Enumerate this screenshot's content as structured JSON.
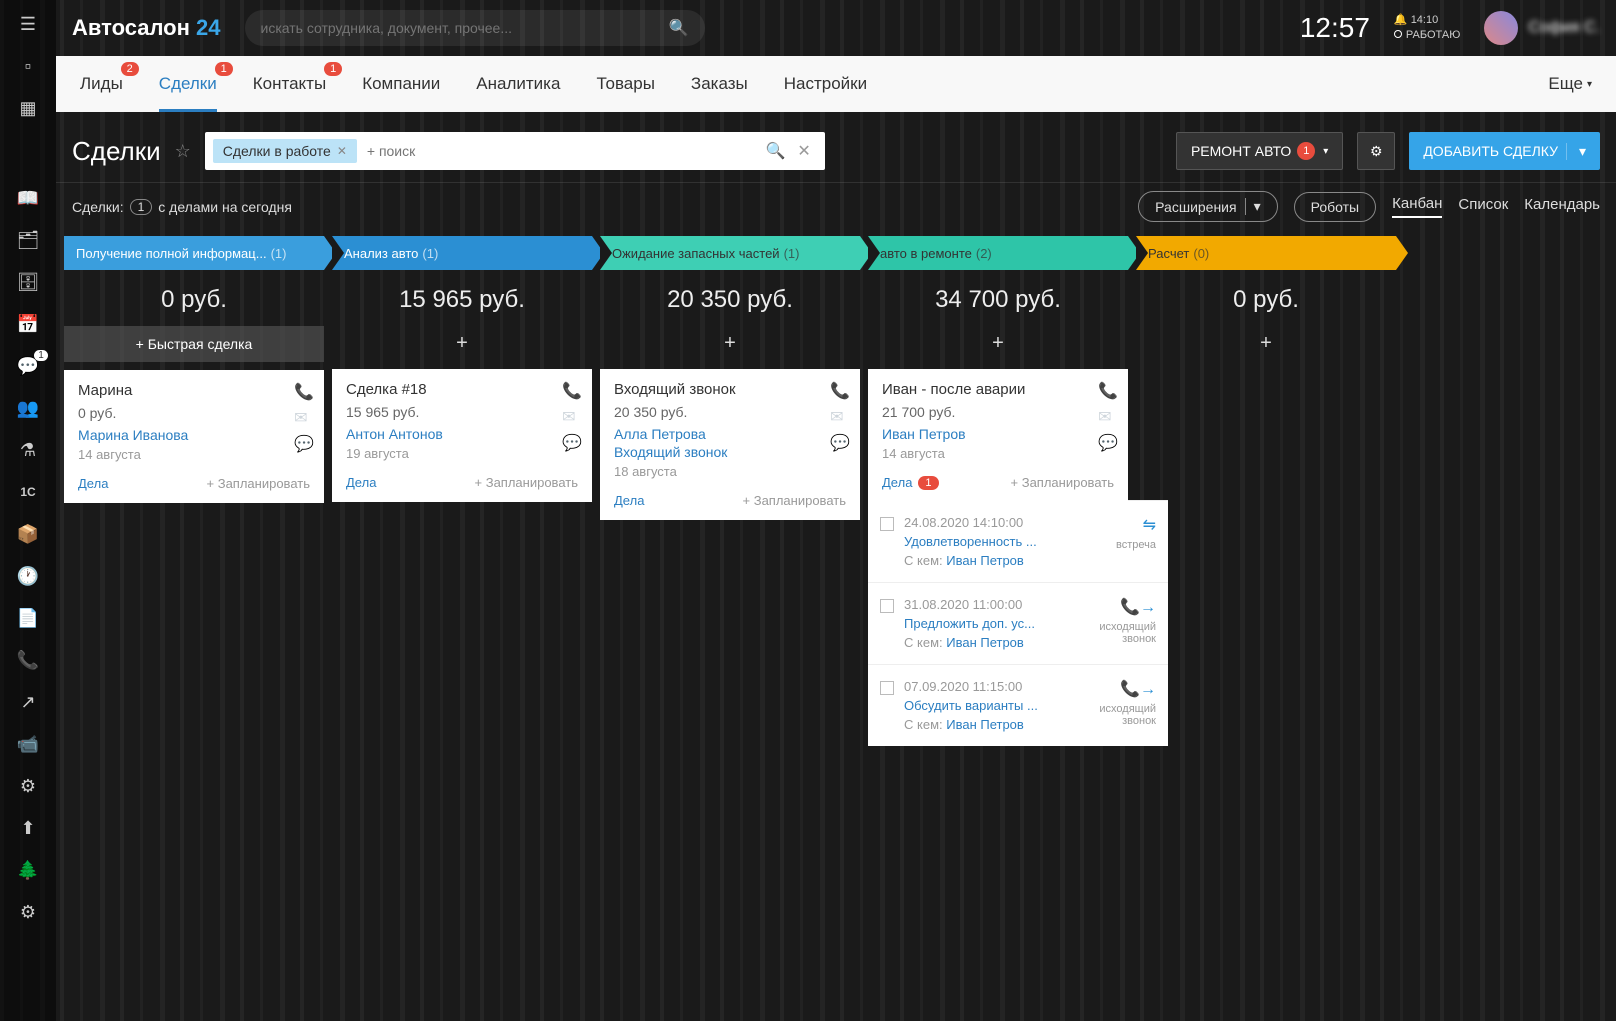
{
  "header": {
    "logo1": "Автосалон ",
    "logo2": "24",
    "search_placeholder": "искать сотрудника, документ, прочее...",
    "clock": "12:57",
    "notif_time": "14:10",
    "status": "РАБОТАЮ",
    "username": "София С."
  },
  "nav": {
    "items": [
      {
        "label": "Лиды",
        "badge": "2"
      },
      {
        "label": "Сделки",
        "badge": "1",
        "active": true
      },
      {
        "label": "Контакты",
        "badge": "1"
      },
      {
        "label": "Компании"
      },
      {
        "label": "Аналитика"
      },
      {
        "label": "Товары"
      },
      {
        "label": "Заказы"
      },
      {
        "label": "Настройки"
      }
    ],
    "more": "Еще"
  },
  "page": {
    "title": "Сделки",
    "filter_chip": "Сделки в работе",
    "filter_placeholder": "+ поиск",
    "funnel_btn": "РЕМОНТ АВТО",
    "funnel_badge": "1",
    "add_btn": "ДОБАВИТЬ СДЕЛКУ"
  },
  "subhead": {
    "label": "Сделки:",
    "count": "1",
    "suffix": "с делами на сегодня",
    "ext": "Расширения",
    "robots": "Роботы",
    "views": [
      "Канбан",
      "Список",
      "Календарь"
    ],
    "active_view": 0
  },
  "columns": [
    {
      "title": "Получение полной информац...",
      "count": "(1)",
      "sum": "0 руб.",
      "color": "h-blue1",
      "quick": true,
      "quick_label": "+  Быстрая сделка"
    },
    {
      "title": "Анализ авто",
      "count": "(1)",
      "sum": "15 965 руб.",
      "color": "h-blue2"
    },
    {
      "title": "Ожидание запасных частей",
      "count": "(1)",
      "sum": "20 350 руб.",
      "color": "h-teal1"
    },
    {
      "title": "авто в ремонте",
      "count": "(2)",
      "sum": "34 700 руб.",
      "color": "h-teal2"
    },
    {
      "title": "Расчет",
      "count": "(0)",
      "sum": "0 руб.",
      "color": "h-orange"
    }
  ],
  "cards": {
    "c0": {
      "title": "Марина",
      "money": "0 руб.",
      "contact": "Марина Иванова",
      "date": "14 августа",
      "dela": "Дела",
      "plan": "+ Запланировать",
      "phone_active": true
    },
    "c1": {
      "title": "Сделка #18",
      "money": "15 965 руб.",
      "contact": "Антон Антонов",
      "date": "19 августа",
      "dela": "Дела",
      "plan": "+ Запланировать"
    },
    "c2": {
      "title": "Входящий звонок",
      "money": "20 350 руб.",
      "contact": "Алла Петрова",
      "contact2": "Входящий звонок",
      "date": "18 августа",
      "dela": "Дела",
      "plan": "+ Запланировать"
    },
    "c3": {
      "title": "Иван - после аварии",
      "money": "21 700 руб.",
      "contact": "Иван Петров",
      "date": "14 августа",
      "dela": "Дела",
      "dela_badge": "1",
      "plan": "+ Запланировать",
      "phone_active": true
    }
  },
  "tasks": [
    {
      "time": "24.08.2020 14:10:00",
      "title": "Удовлетворенность ...",
      "who_prefix": "С кем: ",
      "who": "Иван Петров",
      "type": "встреча",
      "icon": "↔"
    },
    {
      "time": "31.08.2020 11:00:00",
      "title": "Предложить доп. ус...",
      "who_prefix": "С кем: ",
      "who": "Иван Петров",
      "type": "исходящий звонок",
      "icon": "📞→"
    },
    {
      "time": "07.09.2020 11:15:00",
      "title": "Обсудить варианты ...",
      "who_prefix": "С кем: ",
      "who": "Иван Петров",
      "type": "исходящий звонок",
      "icon": "📞→"
    }
  ],
  "icons": {
    "plus": "+",
    "search": "🔍",
    "close": "✕",
    "gear": "⚙",
    "chevron": "▾",
    "bell": "🔔",
    "phone": "📞",
    "mail": "✉",
    "chat": "💬"
  }
}
